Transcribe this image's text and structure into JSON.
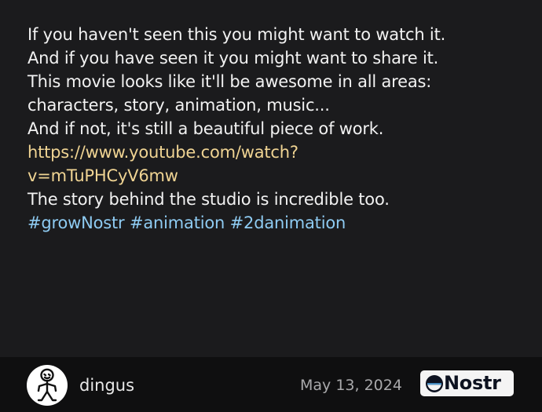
{
  "post": {
    "lines": [
      "If you haven't seen this you might want to watch it.",
      "And if you have seen it you might want to share it.",
      "This movie looks like it'll be awesome in all areas:",
      "characters, story, animation, music...",
      "And if not, it's still a beautiful piece of work."
    ],
    "link": {
      "line1": "https://www.youtube.com/watch?",
      "line2": "v=mTuPHCyV6mw"
    },
    "after_link": "The story behind the studio is incredible too.",
    "hashtags": [
      "#growNostr",
      "#animation",
      "#2danimation"
    ]
  },
  "author": {
    "name": "dingus",
    "avatar_icon": "stick-figure-avatar-icon"
  },
  "timestamp": "May 13, 2024",
  "badge": {
    "label": "Nostr",
    "icon": "nostr-logo-icon"
  },
  "colors": {
    "background": "#1b1b1d",
    "footer": "#0f0f10",
    "text": "#f2f2f2",
    "link": "#f0d493",
    "hashtag": "#8ecbf2",
    "timestamp": "#a9a9ab"
  }
}
